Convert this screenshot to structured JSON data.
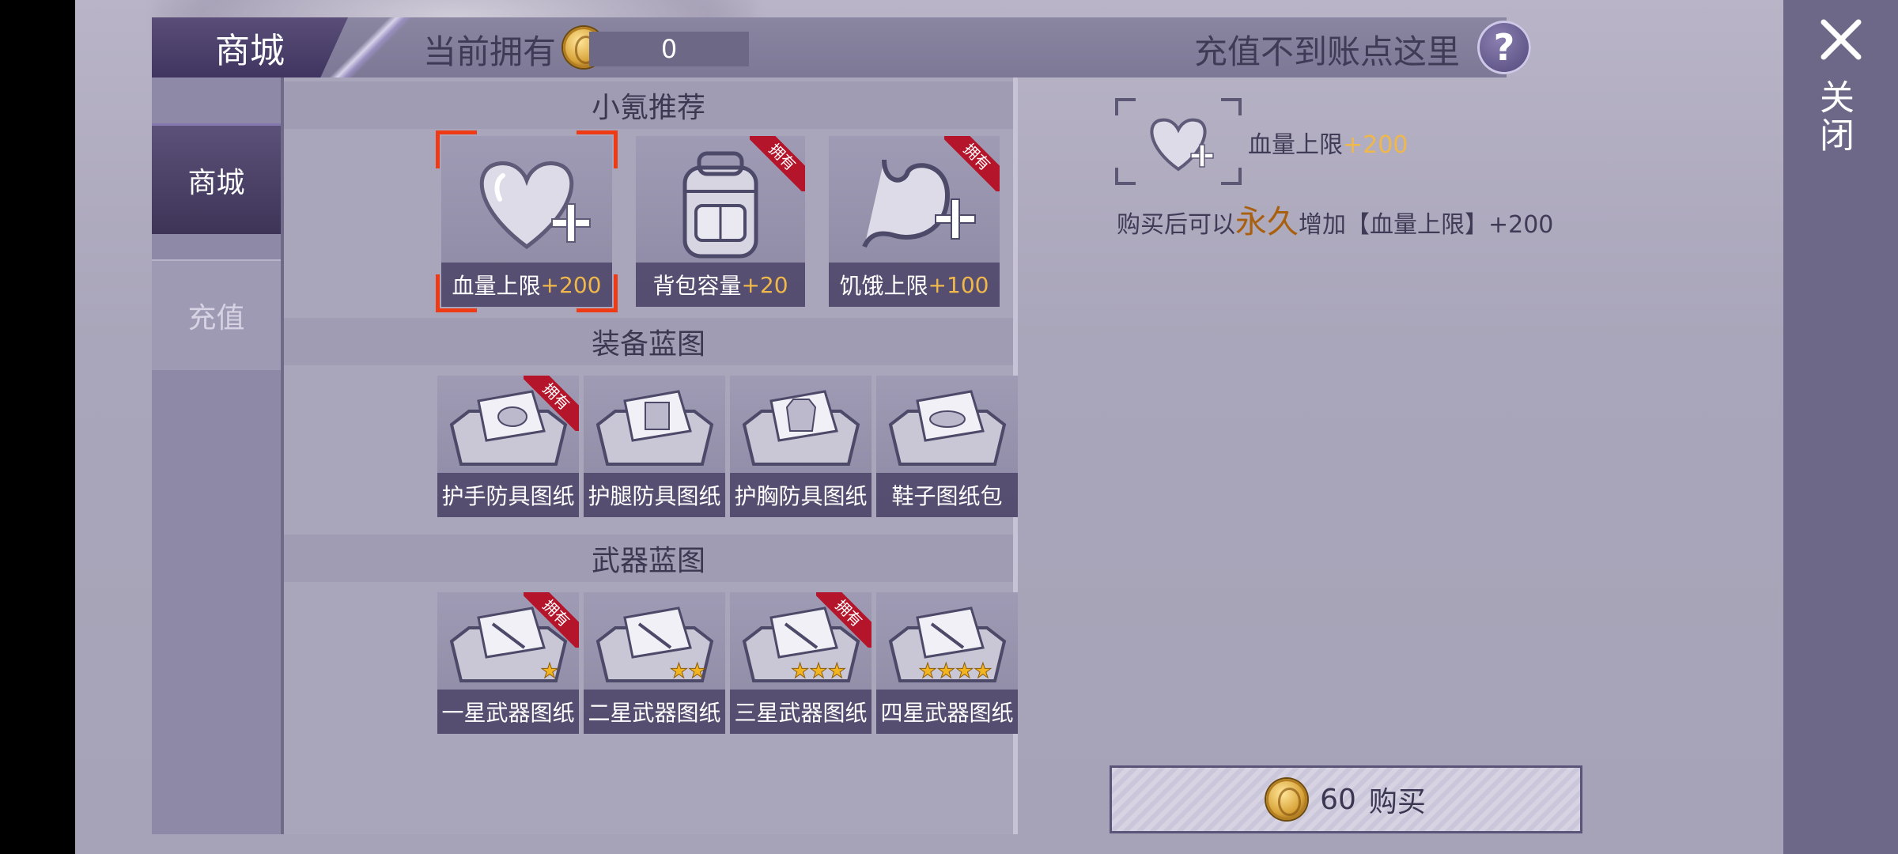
{
  "header": {
    "tab_title": "商城",
    "owned_label": "当前拥有",
    "owned_count": "0",
    "recharge_link": "充值不到账点这里",
    "help_label": "?"
  },
  "sidebar": {
    "items": [
      {
        "label": "商城",
        "active": true
      },
      {
        "label": "充值",
        "active": false
      }
    ]
  },
  "sections": {
    "recommend": {
      "title": "小氪推荐",
      "items": [
        {
          "name": "血量上限",
          "bonus": "+200",
          "icon": "heart-plus-icon",
          "owned": false,
          "selected": true
        },
        {
          "name": "背包容量",
          "bonus": "+20",
          "icon": "backpack-icon",
          "owned": true
        },
        {
          "name": "饥饿上限",
          "bonus": "+100",
          "icon": "stomach-plus-icon",
          "owned": true
        }
      ]
    },
    "armor": {
      "title": "装备蓝图",
      "items": [
        {
          "name": "护手防具图纸",
          "icon": "toolbox-gloves-icon",
          "owned": true
        },
        {
          "name": "护腿防具图纸",
          "icon": "toolbox-pants-icon",
          "owned": false
        },
        {
          "name": "护胸防具图纸",
          "icon": "toolbox-vest-icon",
          "owned": false
        },
        {
          "name": "鞋子图纸包",
          "icon": "toolbox-shoes-icon",
          "owned": false
        }
      ]
    },
    "weapons": {
      "title": "武器蓝图",
      "items": [
        {
          "name": "一星武器图纸",
          "stars": 1,
          "icon": "toolbox-weapon-icon",
          "owned": true
        },
        {
          "name": "二星武器图纸",
          "stars": 2,
          "icon": "toolbox-weapon-icon",
          "owned": false
        },
        {
          "name": "三星武器图纸",
          "stars": 3,
          "icon": "toolbox-weapon-icon",
          "owned": true
        },
        {
          "name": "四星武器图纸",
          "stars": 4,
          "icon": "toolbox-weapon-icon",
          "owned": false
        }
      ]
    },
    "owned_badge": "拥有"
  },
  "detail": {
    "name": "血量上限",
    "bonus": "+200",
    "desc_prefix": "购买后可以",
    "desc_highlight": "永久",
    "desc_suffix": "增加【血量上限】+200",
    "icon": "heart-plus-icon"
  },
  "buy": {
    "price": "60",
    "label": "购买"
  },
  "close": {
    "label": "关闭"
  },
  "colors": {
    "accent_orange": "#ee3b15",
    "bonus_yellow": "#f0b84a",
    "badge_red": "#b5152a",
    "highlight_brown": "#a8600f"
  }
}
